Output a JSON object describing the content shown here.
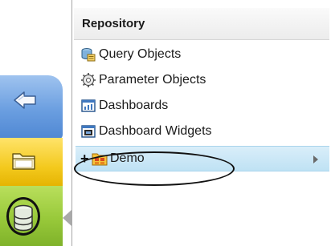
{
  "sidebar": {
    "tabs": [
      {
        "name": "back",
        "icon": "back-arrow-icon",
        "color": "#6a9ee0"
      },
      {
        "name": "folder",
        "icon": "folder-icon",
        "color": "#f3c91d"
      },
      {
        "name": "repository",
        "icon": "database-icon",
        "color": "#98c93a",
        "selected": true
      }
    ]
  },
  "menu": {
    "header": "Repository",
    "items": [
      {
        "label": "Query Objects",
        "icon": "query-objects-icon"
      },
      {
        "label": "Parameter Objects",
        "icon": "parameter-objects-icon"
      },
      {
        "label": "Dashboards",
        "icon": "dashboards-icon"
      },
      {
        "label": "Dashboard Widgets",
        "icon": "dashboard-widgets-icon"
      },
      {
        "label": "Demo",
        "icon": "folder-group-icon",
        "expand": "+",
        "has_submenu": true,
        "highlighted": true
      }
    ]
  }
}
